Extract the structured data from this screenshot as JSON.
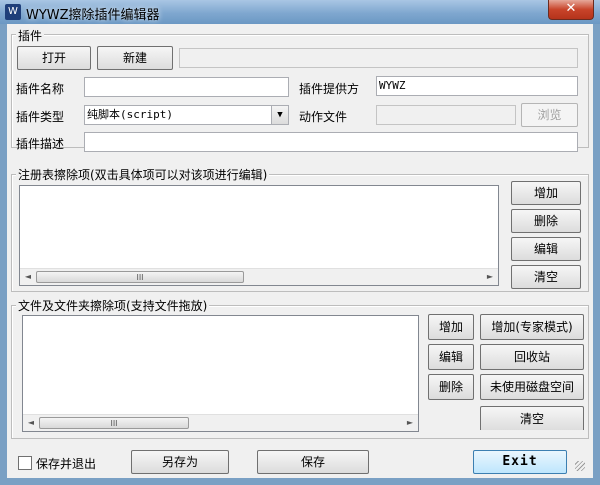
{
  "window": {
    "title": "WYWZ擦除插件编辑器",
    "close_label": "✕",
    "app_icon_glyph": "W"
  },
  "plugin": {
    "group_title": "插件",
    "open_button": "打开",
    "new_button": "新建",
    "path_value": "",
    "name_label": "插件名称",
    "name_value": "",
    "provider_label": "插件提供方",
    "provider_value": "WYWZ",
    "type_label": "插件类型",
    "type_value": "纯脚本(script)",
    "action_file_label": "动作文件",
    "action_file_value": "",
    "browse_button": "浏览",
    "desc_label": "插件描述",
    "desc_value": ""
  },
  "registry": {
    "group_title": "注册表擦除项(双击具体项可以对该项进行编辑)",
    "add_button": "增加",
    "delete_button": "删除",
    "edit_button": "编辑",
    "clear_button": "清空",
    "scroll_left": "◄",
    "scroll_right": "►",
    "thumb_grip": "III",
    "items": []
  },
  "files": {
    "group_title": "文件及文件夹擦除项(支持文件拖放)",
    "add_button": "增加",
    "add_expert_button": "增加(专家模式)",
    "edit_button": "编辑",
    "recycle_button": "回收站",
    "delete_button": "删除",
    "unused_disk_button": "未使用磁盘空间",
    "clear_button": "清空",
    "scroll_left": "◄",
    "scroll_right": "►",
    "thumb_grip": "III",
    "items": []
  },
  "footer": {
    "save_exit_label": "保存并退出",
    "save_exit_checked": false,
    "save_as_button": "另存为",
    "save_button": "保存",
    "exit_button": "Exit"
  },
  "colors": {
    "title_gradient_top": "#a9c6e4",
    "close_red": "#c8442a",
    "client_bg": "#f0f0f0",
    "exit_accent": "#3c7fb1"
  }
}
